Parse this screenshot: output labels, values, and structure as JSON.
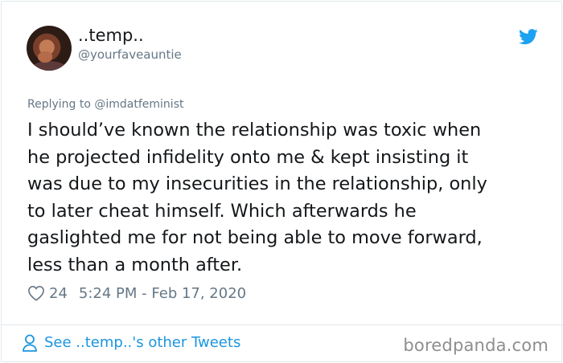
{
  "author": {
    "display_name": "..temp..",
    "handle": "@yourfaveauntie"
  },
  "reply_context": "Replying to @imdatfeminist",
  "tweet": {
    "text": "I should’ve known the relationship was toxic when\nhe projected infidelity onto me & kept insisting it\nwas due to my insecurities in the relationship, only\nto later cheat himself. Which afterwards he\ngaslighted me for not being able to move forward,\nless than a month after."
  },
  "meta": {
    "likes": "24",
    "timestamp": "5:24 PM - Feb 17, 2020"
  },
  "footer": {
    "see_more": "See ..temp..'s other Tweets",
    "watermark": "boredpanda.com"
  },
  "colors": {
    "twitter_blue": "#1da1f2",
    "link_blue": "#1b95e0",
    "muted_gray": "#657786",
    "text": "#14171a"
  },
  "icons": [
    "twitter-bird-icon",
    "heart-icon",
    "person-icon"
  ]
}
